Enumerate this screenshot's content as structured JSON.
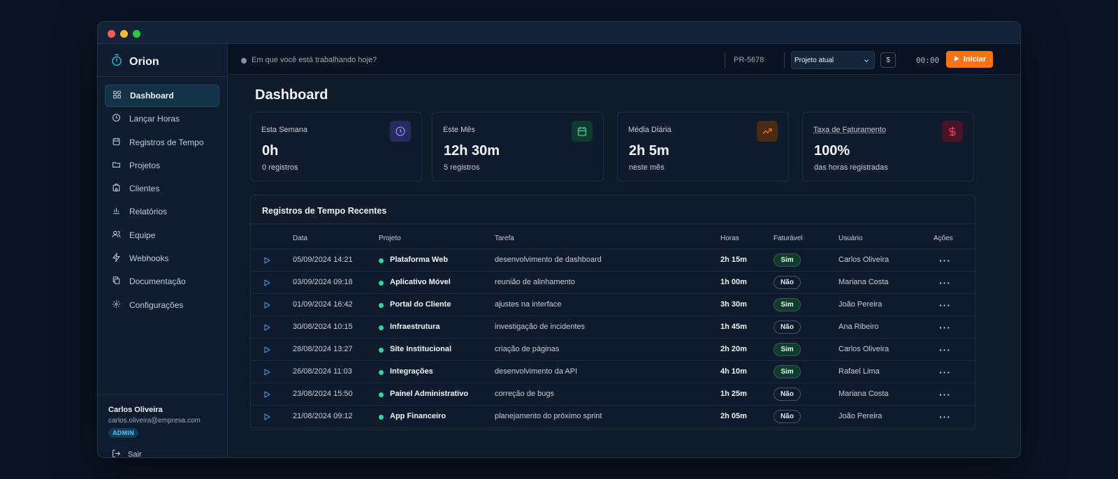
{
  "app": {
    "name": "Orion"
  },
  "colors": {
    "accent": "#f97316",
    "active_nav": "#123247",
    "billable": "#34d399"
  },
  "sidebar": {
    "items": [
      {
        "label": "Dashboard",
        "icon": "grid-icon",
        "active": true
      },
      {
        "label": "Lançar Horas",
        "icon": "clock-icon"
      },
      {
        "label": "Registros de Tempo",
        "icon": "calendar-icon"
      },
      {
        "label": "Projetos",
        "icon": "folder-icon"
      },
      {
        "label": "Clientes",
        "icon": "building-icon"
      },
      {
        "label": "Relatórios",
        "icon": "bar-chart-icon"
      },
      {
        "label": "Equipe",
        "icon": "users-icon"
      },
      {
        "label": "Webhooks",
        "icon": "zap-icon"
      },
      {
        "label": "Documentação",
        "icon": "docs-icon"
      },
      {
        "label": "Configurações",
        "icon": "gear-icon"
      }
    ],
    "user": {
      "name": "Carlos Oliveira",
      "email": "carlos.oliveira@empresa.com",
      "role": "ADMIN"
    },
    "logout_label": "Sair"
  },
  "topbar": {
    "task_placeholder": "Em que você está trabalhando hoje?",
    "ticket": "PR-5678",
    "project_select": "Projeto atual",
    "billable_symbol": "$",
    "timer": "00:00",
    "start_label": "Iniciar"
  },
  "page": {
    "title": "Dashboard"
  },
  "stats": [
    {
      "label": "Esta Semana",
      "value": "0h",
      "sub": "0 registros",
      "icon": "clock-icon"
    },
    {
      "label": "Este Mês",
      "value": "12h 30m",
      "sub": "5 registros",
      "icon": "calendar-icon"
    },
    {
      "label": "Média Diária",
      "value": "2h 5m",
      "sub": "neste mês",
      "icon": "trending-up-icon"
    },
    {
      "label": "Taxa de Faturamento",
      "value": "100%",
      "sub": "das horas registradas",
      "icon": "dollar-icon"
    }
  ],
  "recent": {
    "title": "Registros de Tempo Recentes",
    "columns": [
      "Data",
      "Projeto",
      "Tarefa",
      "Horas",
      "Faturável",
      "Usuário",
      "Ações"
    ],
    "rows": [
      {
        "date": "05/09/2024 14:21",
        "project": "Plataforma Web",
        "task": "desenvolvimento de dashboard",
        "hours": "2h 15m",
        "billable": "Sim",
        "user": "Carlos Oliveira"
      },
      {
        "date": "03/09/2024 09:18",
        "project": "Aplicativo Móvel",
        "task": "reunião de alinhamento",
        "hours": "1h 00m",
        "billable": "Não",
        "user": "Mariana Costa"
      },
      {
        "date": "01/09/2024 16:42",
        "project": "Portal do Cliente",
        "task": "ajustes na interface",
        "hours": "3h 30m",
        "billable": "Sim",
        "user": "João Pereira"
      },
      {
        "date": "30/08/2024 10:15",
        "project": "Infraestrutura",
        "task": "investigação de incidentes",
        "hours": "1h 45m",
        "billable": "Não",
        "user": "Ana Ribeiro"
      },
      {
        "date": "28/08/2024 13:27",
        "project": "Site Institucional",
        "task": "criação de páginas",
        "hours": "2h 20m",
        "billable": "Sim",
        "user": "Carlos Oliveira"
      },
      {
        "date": "26/08/2024 11:03",
        "project": "Integrações",
        "task": "desenvolvimento da API",
        "hours": "4h 10m",
        "billable": "Sim",
        "user": "Rafael Lima"
      },
      {
        "date": "23/08/2024 15:50",
        "project": "Painel Administrativo",
        "task": "correção de bugs",
        "hours": "1h 25m",
        "billable": "Não",
        "user": "Mariana Costa"
      },
      {
        "date": "21/08/2024 09:12",
        "project": "App Financeiro",
        "task": "planejamento do próximo sprint",
        "hours": "2h 05m",
        "billable": "Não",
        "user": "João Pereira"
      }
    ]
  }
}
